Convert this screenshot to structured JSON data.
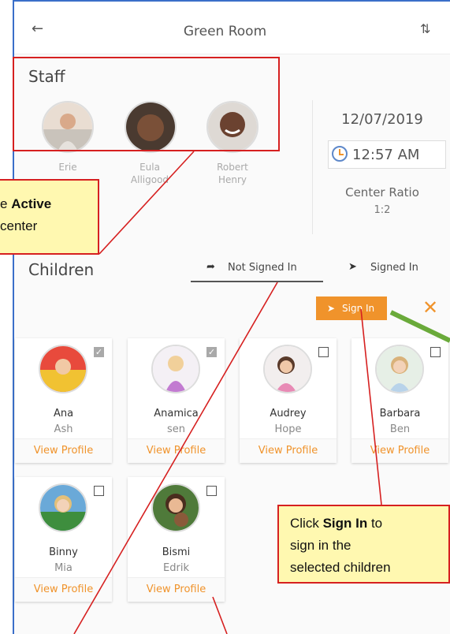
{
  "header": {
    "back_icon": "arrow-left-icon",
    "title": "Green Room",
    "sort_icon": "sort-arrows-icon"
  },
  "staff": {
    "heading": "Staff",
    "members": [
      {
        "first": "Erie",
        "last": ""
      },
      {
        "first": "Eula",
        "last": "Alligood"
      },
      {
        "first": "Robert",
        "last": "Henry"
      }
    ]
  },
  "info": {
    "date": "12/07/2019",
    "time": "12:57 AM",
    "ratio_label": "Center Ratio",
    "ratio_value": "1:2"
  },
  "children": {
    "heading": "Children",
    "tabs": [
      {
        "label": "Not Signed In",
        "active": true
      },
      {
        "label": "Signed In",
        "active": false
      }
    ],
    "sign_in_button": "Sign In",
    "list": [
      {
        "first": "Ana",
        "last": "Ash",
        "checked": true,
        "action": "View Profile"
      },
      {
        "first": "Anamica",
        "last": "sen",
        "checked": true,
        "action": "View Profile"
      },
      {
        "first": "Audrey",
        "last": "Hope",
        "checked": false,
        "action": "View Profile"
      },
      {
        "first": "Barbara",
        "last": "Ben",
        "checked": false,
        "action": "View Profile"
      },
      {
        "first": "Binny",
        "last": "Mia",
        "checked": false,
        "action": "View Profile"
      },
      {
        "first": "Bismi",
        "last": "Edrik",
        "checked": false,
        "action": "View Profile"
      }
    ]
  },
  "callouts": {
    "active_prefix": "e ",
    "active_bold": "Active",
    "active_line2": "center",
    "signin_click": "Click ",
    "signin_bold": "Sign In",
    "signin_to": " to",
    "signin_line2": "sign in the",
    "signin_line3": "selected children"
  },
  "colors": {
    "accent": "#f0932b",
    "highlight": "#d62020",
    "callout_bg": "#fff8b0",
    "arrow_green": "#6aaa3a",
    "frame_blue": "#3a6fc9"
  }
}
